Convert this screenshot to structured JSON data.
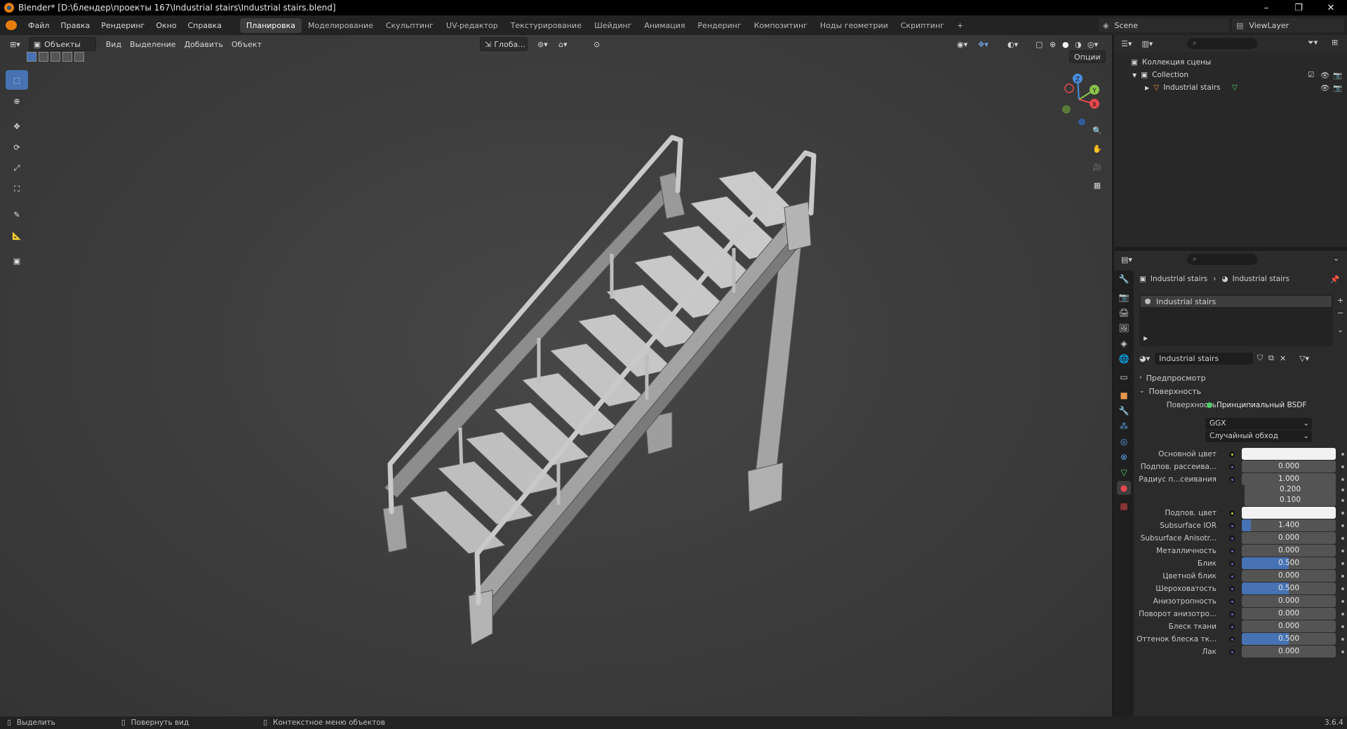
{
  "window": {
    "title": "Blender* [D:\\блендер\\проекты 167\\Industrial stairs\\Industrial stairs.blend]",
    "minimize": "–",
    "maximize": "❐",
    "close": "✕"
  },
  "menu": [
    "Файл",
    "Правка",
    "Рендеринг",
    "Окно",
    "Справка"
  ],
  "workspaces": [
    "Планировка",
    "Моделирование",
    "Скульптинг",
    "UV-редактор",
    "Текстурирование",
    "Шейдинг",
    "Анимация",
    "Рендеринг",
    "Композитинг",
    "Ноды геометрии",
    "Скриптинг",
    "+"
  ],
  "active_workspace": "Планировка",
  "scene": {
    "scene_name": "Scene",
    "view_layer": "ViewLayer"
  },
  "viewport": {
    "mode": "Объекты",
    "menus": [
      "Вид",
      "Выделение",
      "Добавить",
      "Объект"
    ],
    "transform_orientation": "Глоба...",
    "options": "Опции",
    "gizmo_axes": [
      "X",
      "Y",
      "Z"
    ]
  },
  "outliner": {
    "scene_collection": "Коллекция сцены",
    "collection": "Collection",
    "object": "Industrial stairs"
  },
  "properties": {
    "breadcrumb_object": "Industrial stairs",
    "breadcrumb_material": "Industrial stairs",
    "material_slot": "Industrial stairs",
    "material_name": "Industrial stairs",
    "panel_preview": "Предпросмотр",
    "panel_surface": "Поверхность",
    "surface_label": "Поверхность",
    "surface_value": "Принципиальный BSDF",
    "distribution": "GGX",
    "subsurface_method": "Случайный обход",
    "rows": [
      {
        "label": "Основной цвет",
        "type": "color",
        "value": ""
      },
      {
        "label": "Подпов. рассеива...",
        "type": "num",
        "value": "0.000",
        "fill": 0
      },
      {
        "label": "Радиус п...сеивания",
        "type": "num",
        "value": "1.000",
        "fill": 0
      },
      {
        "label": "",
        "type": "num",
        "value": "0.200",
        "fill": 0
      },
      {
        "label": "",
        "type": "num",
        "value": "0.100",
        "fill": 0
      },
      {
        "label": "Подпов. цвет",
        "type": "color",
        "value": ""
      },
      {
        "label": "Subsurface IOR",
        "type": "num",
        "value": "1.400",
        "fill": 0.1
      },
      {
        "label": "Subsurface Anisotr...",
        "type": "num",
        "value": "0.000",
        "fill": 0
      },
      {
        "label": "Металличность",
        "type": "num",
        "value": "0.000",
        "fill": 0
      },
      {
        "label": "Блик",
        "type": "num",
        "value": "0.500",
        "fill": 0.5
      },
      {
        "label": "Цветной блик",
        "type": "num",
        "value": "0.000",
        "fill": 0
      },
      {
        "label": "Шероховатость",
        "type": "num",
        "value": "0.500",
        "fill": 0.5
      },
      {
        "label": "Анизотропность",
        "type": "num",
        "value": "0.000",
        "fill": 0
      },
      {
        "label": "Поворот анизотро...",
        "type": "num",
        "value": "0.000",
        "fill": 0
      },
      {
        "label": "Блеск ткани",
        "type": "num",
        "value": "0.000",
        "fill": 0
      },
      {
        "label": "Оттенок блеска тк...",
        "type": "num",
        "value": "0.500",
        "fill": 0.5
      },
      {
        "label": "Лак",
        "type": "num",
        "value": "0.000",
        "fill": 0
      }
    ]
  },
  "statusbar": {
    "select": "Выделить",
    "rotate": "Повернуть вид",
    "context": "Контекстное меню объектов",
    "version": "3.6.4"
  },
  "colors": {
    "accent": "#4772b3",
    "active_tool": "#4772b3",
    "x_axis": "#e5484d",
    "y_axis": "#8bc34a",
    "z_axis": "#4a8fe0"
  }
}
